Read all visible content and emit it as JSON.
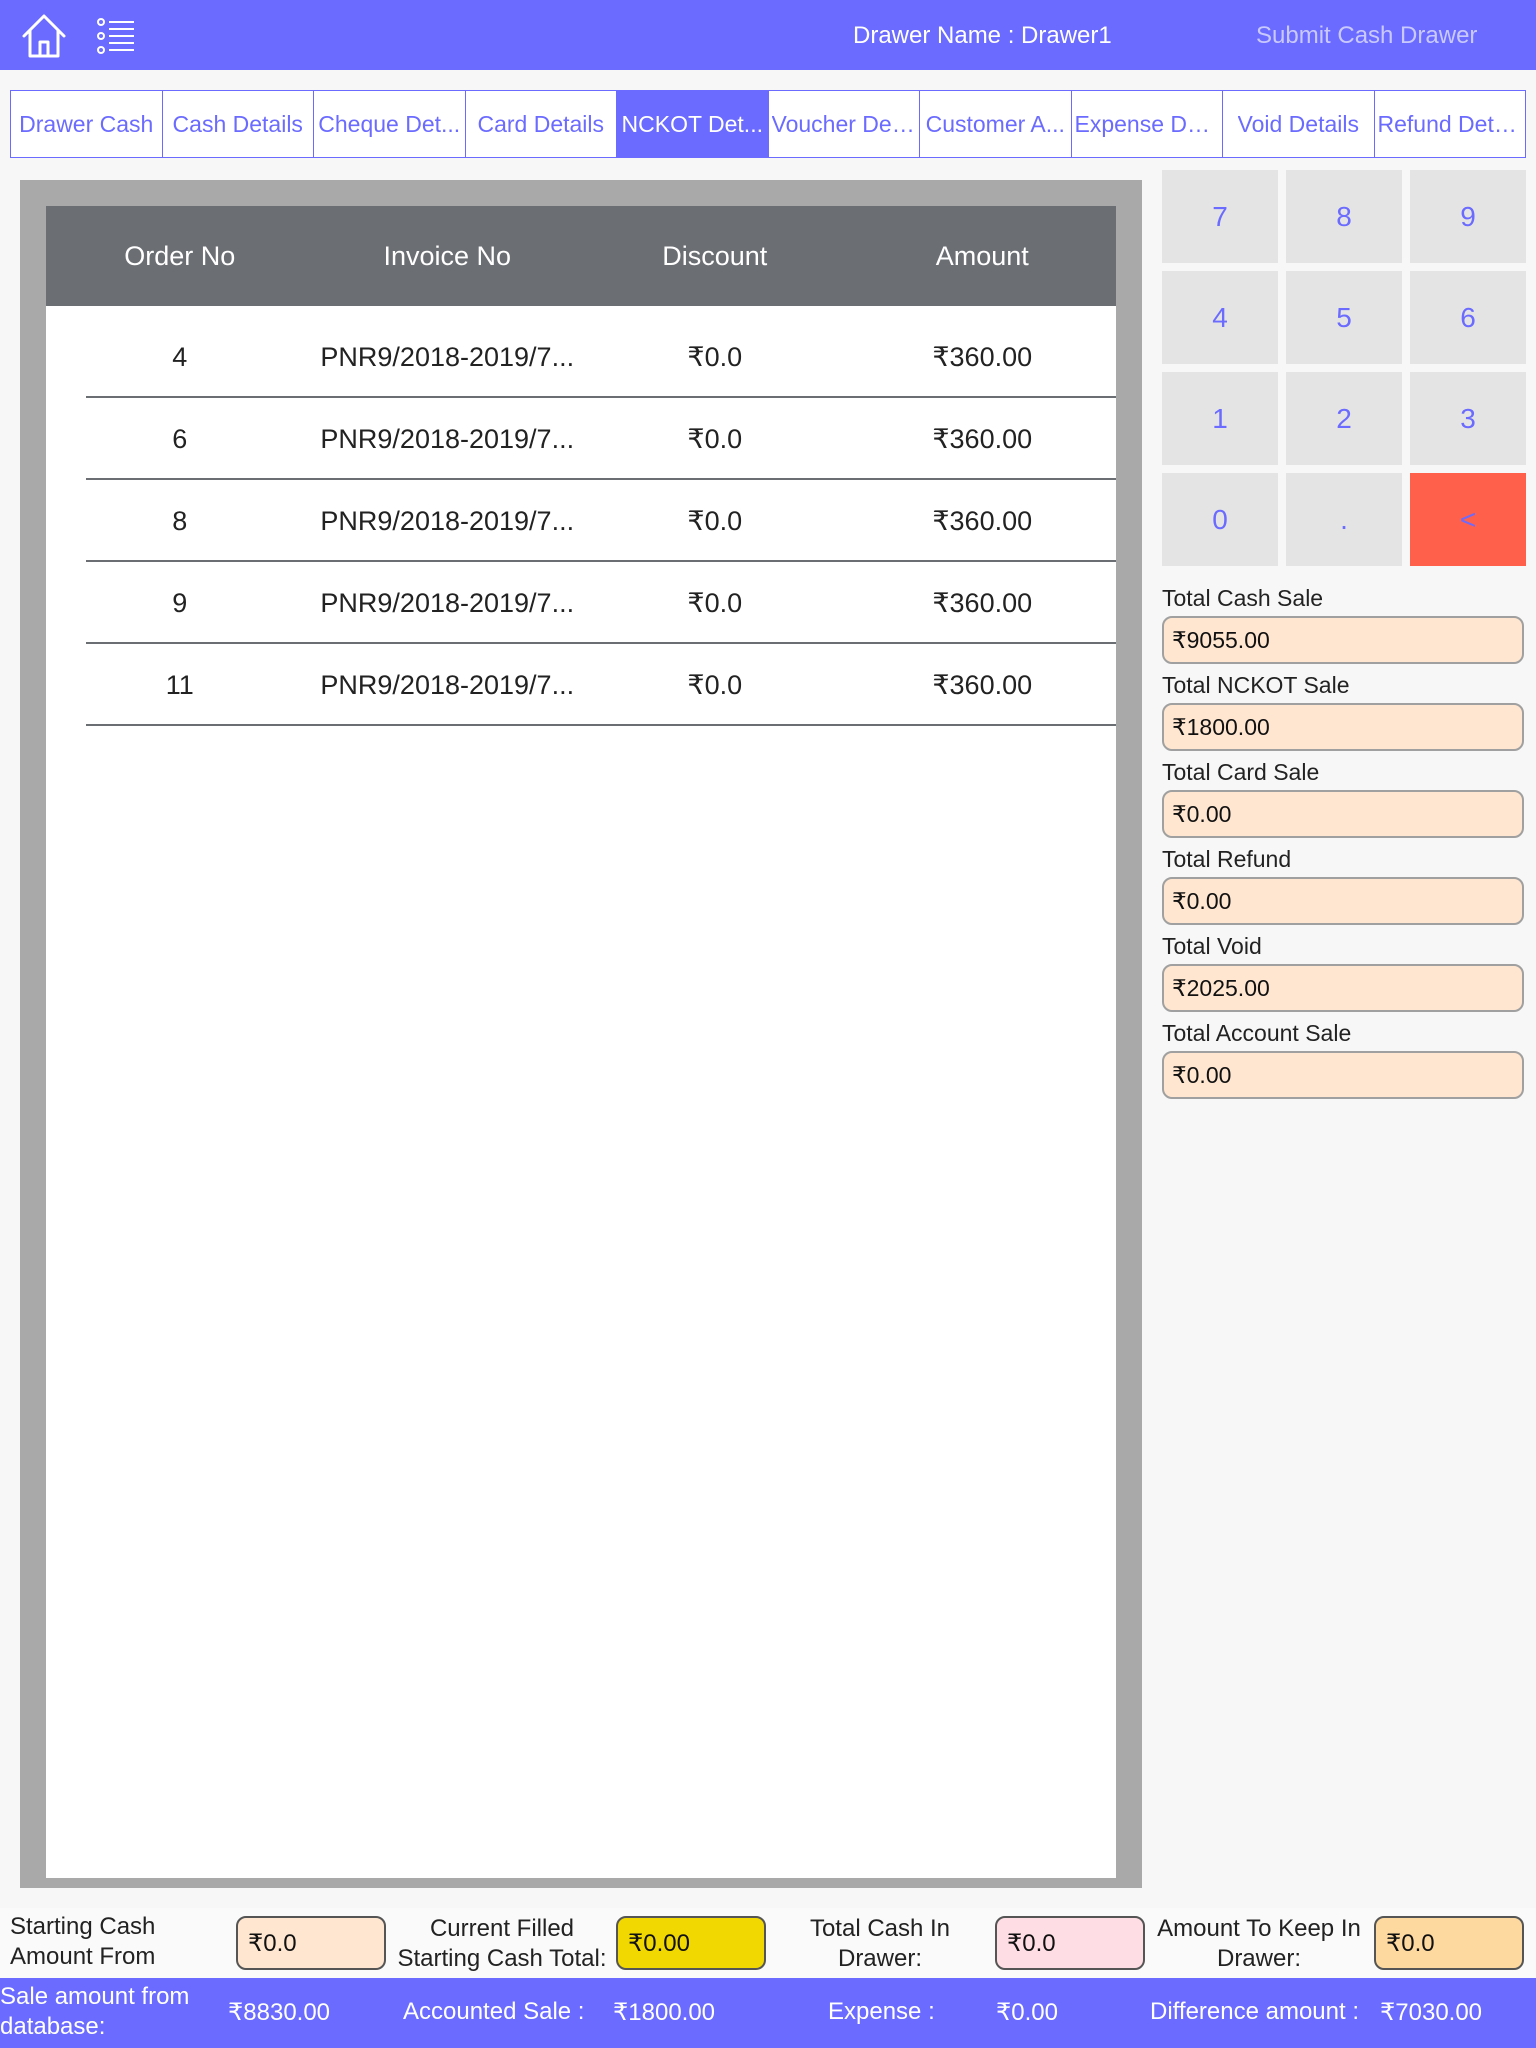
{
  "header": {
    "home_icon": "home-icon",
    "menu_icon": "list-icon",
    "drawer_name": "Drawer Name : Drawer1",
    "submit_label": "Submit Cash Drawer"
  },
  "tabs": [
    {
      "label": "Drawer Cash",
      "active": false
    },
    {
      "label": "Cash Details",
      "active": false
    },
    {
      "label": "Cheque Det...",
      "active": false
    },
    {
      "label": "Card Details",
      "active": false
    },
    {
      "label": "NCKOT Det...",
      "active": true
    },
    {
      "label": "Voucher Det...",
      "active": false
    },
    {
      "label": "Customer A...",
      "active": false
    },
    {
      "label": "Expense Det...",
      "active": false
    },
    {
      "label": "Void Details",
      "active": false
    },
    {
      "label": "Refund Deta...",
      "active": false
    }
  ],
  "table": {
    "columns": [
      "Order No",
      "Invoice No",
      "Discount",
      "Amount"
    ],
    "rows": [
      [
        "4",
        "PNR9/2018-2019/7...",
        "₹0.0",
        "₹360.00"
      ],
      [
        "6",
        "PNR9/2018-2019/7...",
        "₹0.0",
        "₹360.00"
      ],
      [
        "8",
        "PNR9/2018-2019/7...",
        "₹0.0",
        "₹360.00"
      ],
      [
        "9",
        "PNR9/2018-2019/7...",
        "₹0.0",
        "₹360.00"
      ],
      [
        "11",
        "PNR9/2018-2019/7...",
        "₹0.0",
        "₹360.00"
      ]
    ]
  },
  "keypad": [
    "7",
    "8",
    "9",
    "4",
    "5",
    "6",
    "1",
    "2",
    "3",
    "0",
    ".",
    "<"
  ],
  "totals": [
    {
      "label": "Total Cash Sale",
      "value": "₹9055.00"
    },
    {
      "label": "Total NCKOT Sale",
      "value": "₹1800.00"
    },
    {
      "label": "Total Card Sale",
      "value": "₹0.00"
    },
    {
      "label": "Total Refund",
      "value": "₹0.00"
    },
    {
      "label": "Total Void",
      "value": "₹2025.00"
    },
    {
      "label": "Total Account Sale",
      "value": "₹0.00"
    }
  ],
  "bottom": {
    "starting_cash_label": "Starting Cash Amount From",
    "starting_cash_value": "₹0.0",
    "current_filled_label": "Current Filled Starting Cash Total:",
    "current_filled_value": "₹0.00",
    "total_cash_label": "Total Cash In Drawer:",
    "total_cash_value": "₹0.0",
    "keep_label": "Amount To Keep In Drawer:",
    "keep_value": "₹0.0"
  },
  "footer": {
    "sale_db_label": "Sale amount from database:",
    "sale_db_value": "₹8830.00",
    "accounted_label": "Accounted Sale :",
    "accounted_value": "₹1800.00",
    "expense_label": "Expense :",
    "expense_value": "₹0.00",
    "difference_label": "Difference amount :",
    "difference_value": "₹7030.00"
  },
  "colors": {
    "accent": "#6b6bff",
    "table_header": "#6b6e73",
    "field_bg": "#ffe6d0",
    "current_filled_bg": "#f0d800",
    "total_cash_bg": "#ffdde4",
    "keep_bg": "#fdd9a0",
    "backspace_bg": "#ff604b"
  }
}
